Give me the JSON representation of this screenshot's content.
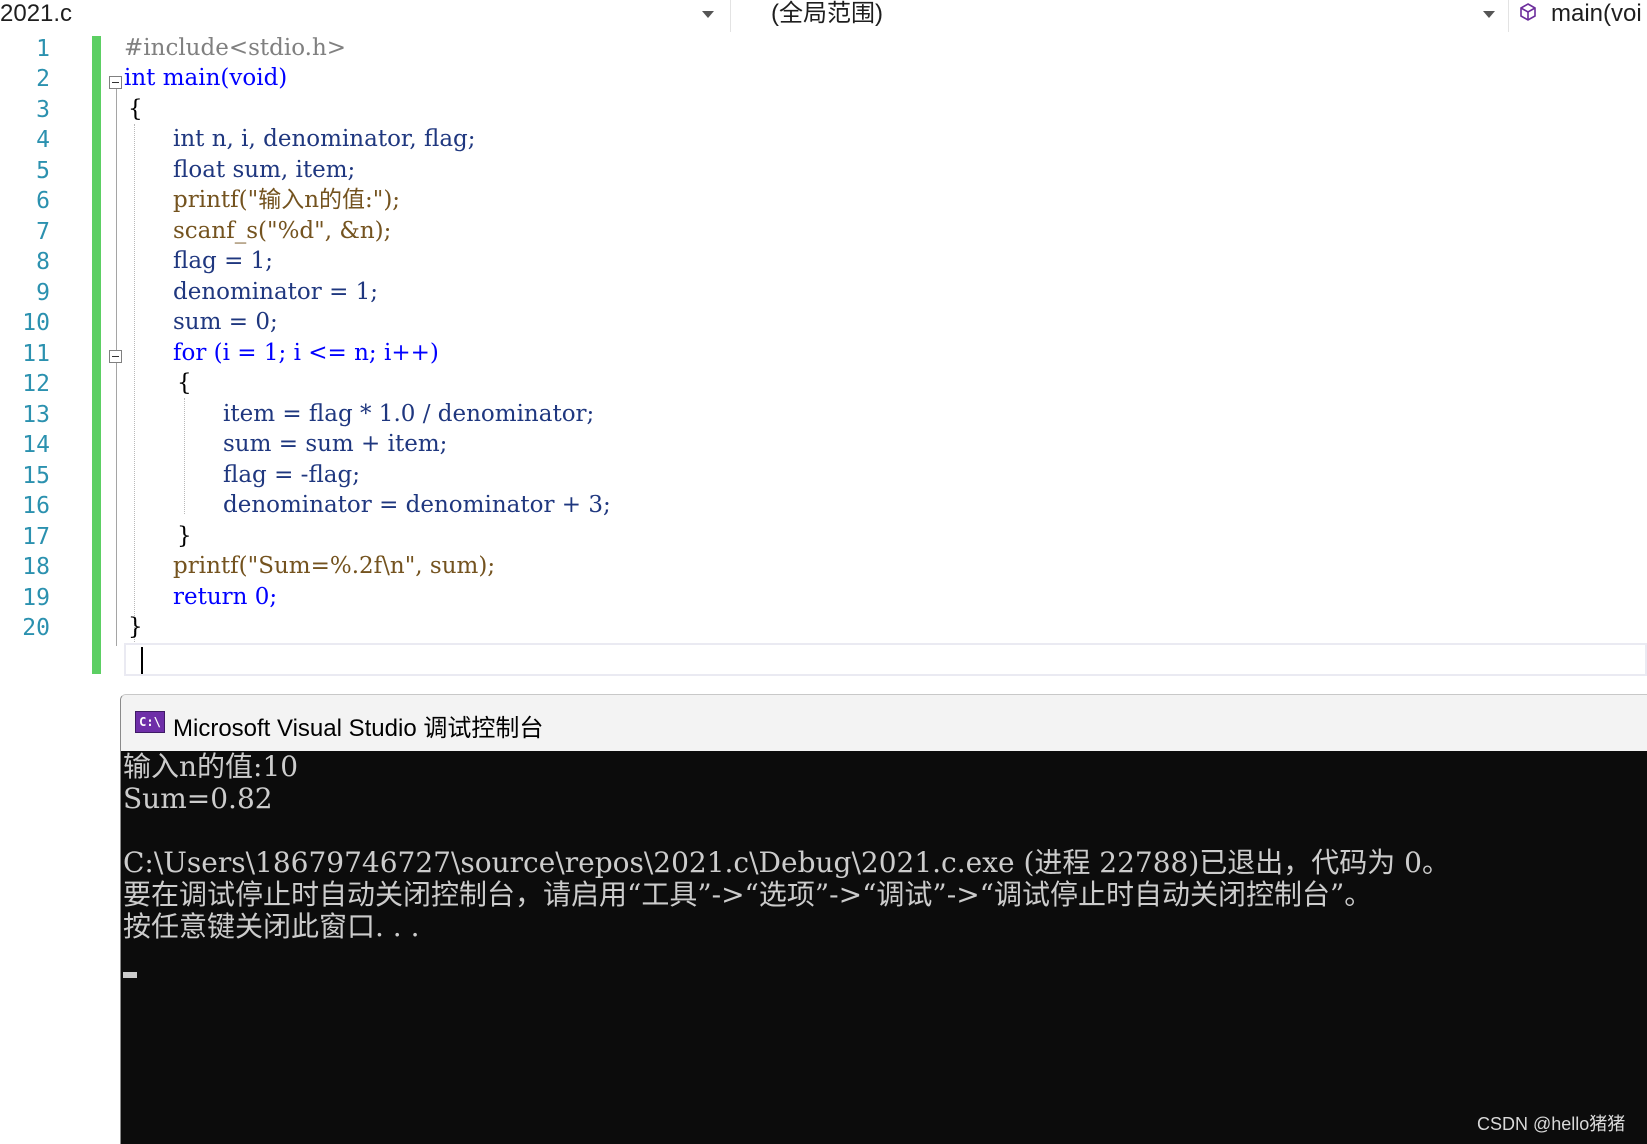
{
  "navbar": {
    "file_dropdown": "2021.c",
    "scope_dropdown": "(全局范围)",
    "member_dropdown": "main(voi"
  },
  "editor": {
    "line_numbers": [
      "1",
      "2",
      "3",
      "4",
      "5",
      "6",
      "7",
      "8",
      "9",
      "10",
      "11",
      "12",
      "13",
      "14",
      "15",
      "16",
      "17",
      "18",
      "19",
      "20"
    ],
    "lines": [
      "#include<stdio.h>",
      "int main(void)",
      "{",
      "int n, i, denominator, flag;",
      "float sum, item;",
      "printf(\"输入n的值:\");",
      "scanf_s(\"%d\", &n);",
      "flag = 1;",
      "denominator = 1;",
      "sum = 0;",
      "for (i = 1; i <= n; i++)",
      "{",
      "item = flag * 1.0 / denominator;",
      "sum = sum + item;",
      "flag = -flag;",
      "denominator = denominator + 3;",
      "}",
      "printf(\"Sum=%.2f\\n\", sum);",
      "return 0;",
      "}"
    ]
  },
  "console": {
    "title": "Microsoft Visual Studio 调试控制台",
    "icon_label": "C:\\",
    "lines": [
      "输入n的值:10",
      "Sum=0.82",
      "",
      "C:\\Users\\18679746727\\source\\repos\\2021.c\\Debug\\2021.c.exe (进程 22788)已退出，代码为 0。",
      "要在调试停止时自动关闭控制台，请启用“工具”->“选项”->“调试”->“调试停止时自动关闭控制台”。",
      "按任意键关闭此窗口. . ."
    ]
  },
  "watermark": "CSDN @hello猪猪",
  "colors": {
    "keyword": "#0000ff",
    "function": "#74531f",
    "variable": "#1f377f",
    "string": "#a31515",
    "line_number": "#2b91af",
    "change_bar": "#5ccf63",
    "console_bg": "#0c0c0c",
    "console_text": "#cccccc"
  }
}
